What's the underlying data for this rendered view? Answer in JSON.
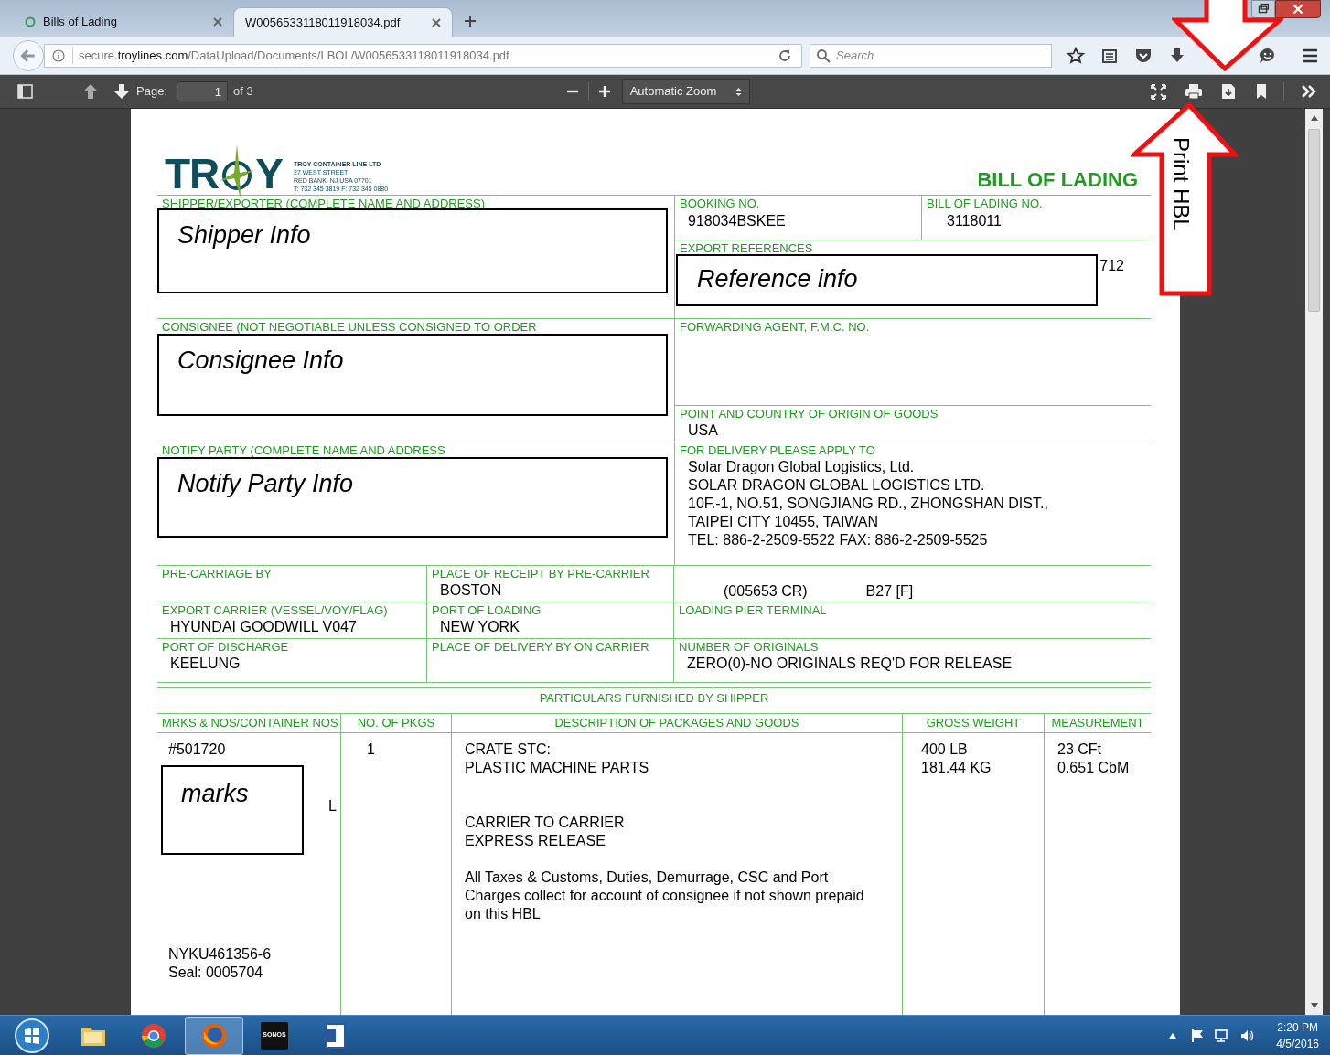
{
  "browser": {
    "tabs": [
      {
        "title": "Bills of Lading",
        "selected": false
      },
      {
        "title": "W0056533118011918034.pdf",
        "selected": true
      }
    ],
    "url": {
      "prefix": "secure.",
      "domain": "troylines.com",
      "path": "/DataUpload/Documents/LBOL/W0056533118011918034.pdf"
    },
    "search": {
      "placeholder": "Search"
    }
  },
  "pdf_toolbar": {
    "page_label": "Page:",
    "page": "1",
    "page_count": "of 3",
    "zoom": "Automatic Zoom"
  },
  "document": {
    "title": "BILL OF LADING",
    "company": {
      "logo": [
        "TR",
        "Y"
      ],
      "name": "TROY CONTAINER LINE LTD",
      "address_lines": [
        "27 WEST STREET",
        "RED BANK, NJ USA 07701",
        "T: 732 345 3819  F: 732 345 0880"
      ]
    },
    "shipper": {
      "label": "SHIPPER/EXPORTER (COMPLETE NAME AND ADDRESS)"
    },
    "booking_no": {
      "label": "BOOKING NO.",
      "value": "918034BSKEE"
    },
    "bill_of_lading_no": {
      "label": "BILL OF LADING NO.",
      "value": "3118011"
    },
    "export_references": {
      "label": "EXPORT REFERENCES",
      "value": "712"
    },
    "consignee": {
      "label": "CONSIGNEE (NOT NEGOTIABLE UNLESS CONSIGNED TO ORDER"
    },
    "forwarding_agent": {
      "label": "FORWARDING AGENT, F.M.C. NO."
    },
    "origin": {
      "label": "POINT AND COUNTRY OF ORIGIN OF GOODS",
      "value": "USA"
    },
    "notify_party": {
      "label": "NOTIFY PARTY (COMPLETE NAME AND ADDRESS"
    },
    "delivery": {
      "label": "FOR DELIVERY PLEASE APPLY TO",
      "lines": [
        "Solar Dragon Global Logistics, Ltd.",
        "SOLAR DRAGON GLOBAL LOGISTICS LTD.",
        "10F.-1, NO.51, SONGJIANG RD., ZHONGSHAN DIST.,",
        "TAIPEI CITY 10455, TAIWAN",
        "TEL: 886-2-2509-5522 FAX: 886-2-2509-5525"
      ]
    },
    "routing": [
      [
        {
          "label": "PRE-CARRIAGE BY"
        },
        {
          "label": "PLACE OF RECEIPT BY PRE-CARRIER",
          "value": "BOSTON"
        },
        {
          "values": [
            "(005653 CR)",
            "B27 [F]"
          ]
        }
      ],
      [
        {
          "label": "EXPORT CARRIER (VESSEL/VOY/FLAG)",
          "value": "HYUNDAI GOODWILL V047"
        },
        {
          "label": "PORT OF LOADING",
          "value": "NEW YORK"
        },
        {
          "label": "LOADING PIER TERMINAL"
        }
      ],
      [
        {
          "label": "PORT OF DISCHARGE",
          "value": "KEELUNG"
        },
        {
          "label": "PLACE OF DELIVERY BY ON CARRIER"
        },
        {
          "label": "NUMBER OF ORIGINALS",
          "value": "ZERO(0)-NO ORIGINALS REQ'D FOR RELEASE"
        }
      ]
    ],
    "particulars": {
      "title": "PARTICULARS FURNISHED BY SHIPPER",
      "columns": [
        {
          "heading": "MRKS & NOS/CONTAINER NOS",
          "blocks": [
            {
              "kind": "top",
              "lines": [
                "#501720"
              ]
            },
            {
              "kind": "hidden",
              "lines": [
                "L"
              ]
            },
            {
              "kind": "bottom",
              "lines": [
                "NYKU461356-6",
                "Seal: 0005704"
              ]
            }
          ]
        },
        {
          "heading": "NO. OF PKGS",
          "blocks": [
            {
              "kind": "top",
              "lines": [
                "1"
              ]
            }
          ]
        },
        {
          "heading": "DESCRIPTION OF PACKAGES AND GOODS",
          "blocks": [
            {
              "kind": "top",
              "lines": [
                "CRATE STC:",
                "PLASTIC MACHINE PARTS"
              ]
            },
            {
              "kind": "gap",
              "lines": [
                "CARRIER TO CARRIER",
                "EXPRESS RELEASE"
              ]
            },
            {
              "kind": "near",
              "lines": [
                "All Taxes & Customs, Duties, Demurrage, CSC and Port",
                "Charges collect for account of consignee if not shown prepaid",
                "on this HBL"
              ]
            }
          ]
        },
        {
          "heading": "GROSS WEIGHT",
          "blocks": [
            {
              "kind": "top",
              "lines": [
                "400 LB",
                "181.44 KG"
              ]
            }
          ]
        },
        {
          "heading": "MEASUREMENT",
          "blocks": [
            {
              "kind": "top",
              "lines": [
                "23 CFt",
                "0.651 CbM"
              ]
            }
          ]
        }
      ]
    }
  },
  "annotations": [
    {
      "text": "Shipper Info"
    },
    {
      "text": "Reference info"
    },
    {
      "text": "Consignee Info"
    },
    {
      "text": "Notify Party Info"
    },
    {
      "text": "marks"
    }
  ],
  "callout": {
    "text": "Print HBL"
  },
  "taskbar": {
    "apps": [
      {
        "kind": "explorer",
        "selected": false
      },
      {
        "kind": "chrome",
        "selected": false
      },
      {
        "kind": "firefox",
        "selected": true
      },
      {
        "kind": "sonos",
        "label": "SONOS",
        "selected": false
      },
      {
        "kind": "word",
        "selected": false
      }
    ],
    "time": "2:20 PM",
    "date": "4/5/2016"
  }
}
